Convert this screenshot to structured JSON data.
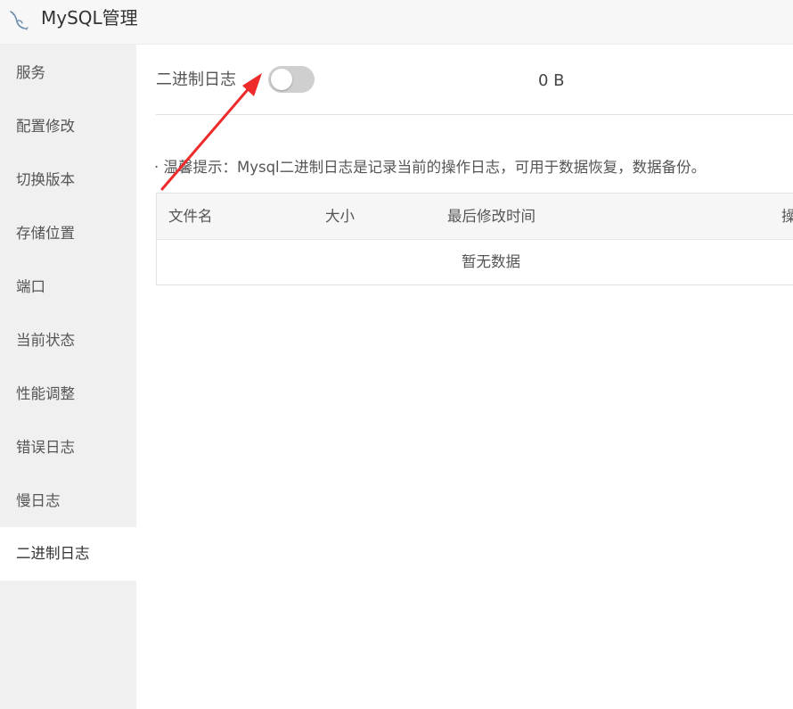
{
  "app": {
    "title": "MySQL管理",
    "logo_icon": "mysql-dolphin-icon"
  },
  "sidebar": {
    "items": [
      {
        "label": "服务"
      },
      {
        "label": "配置修改"
      },
      {
        "label": "切换版本"
      },
      {
        "label": "存储位置"
      },
      {
        "label": "端口"
      },
      {
        "label": "当前状态"
      },
      {
        "label": "性能调整"
      },
      {
        "label": "错误日志"
      },
      {
        "label": "慢日志"
      },
      {
        "label": "二进制日志",
        "active": true
      }
    ]
  },
  "binlog": {
    "label": "二进制日志",
    "enabled": false,
    "size": "0 B",
    "tip": "· 温馨提示：Mysql二进制日志是记录当前的操作日志，可用于数据恢复，数据备份。"
  },
  "table": {
    "columns": [
      "文件名",
      "大小",
      "最后修改时间",
      "操"
    ],
    "rows": [],
    "empty_text": "暂无数据"
  },
  "colors": {
    "sidebar_bg": "#f0f0f0",
    "active_bg": "#ffffff",
    "toggle_off": "#cfcfcf",
    "arrow": "#ee2a2a"
  }
}
